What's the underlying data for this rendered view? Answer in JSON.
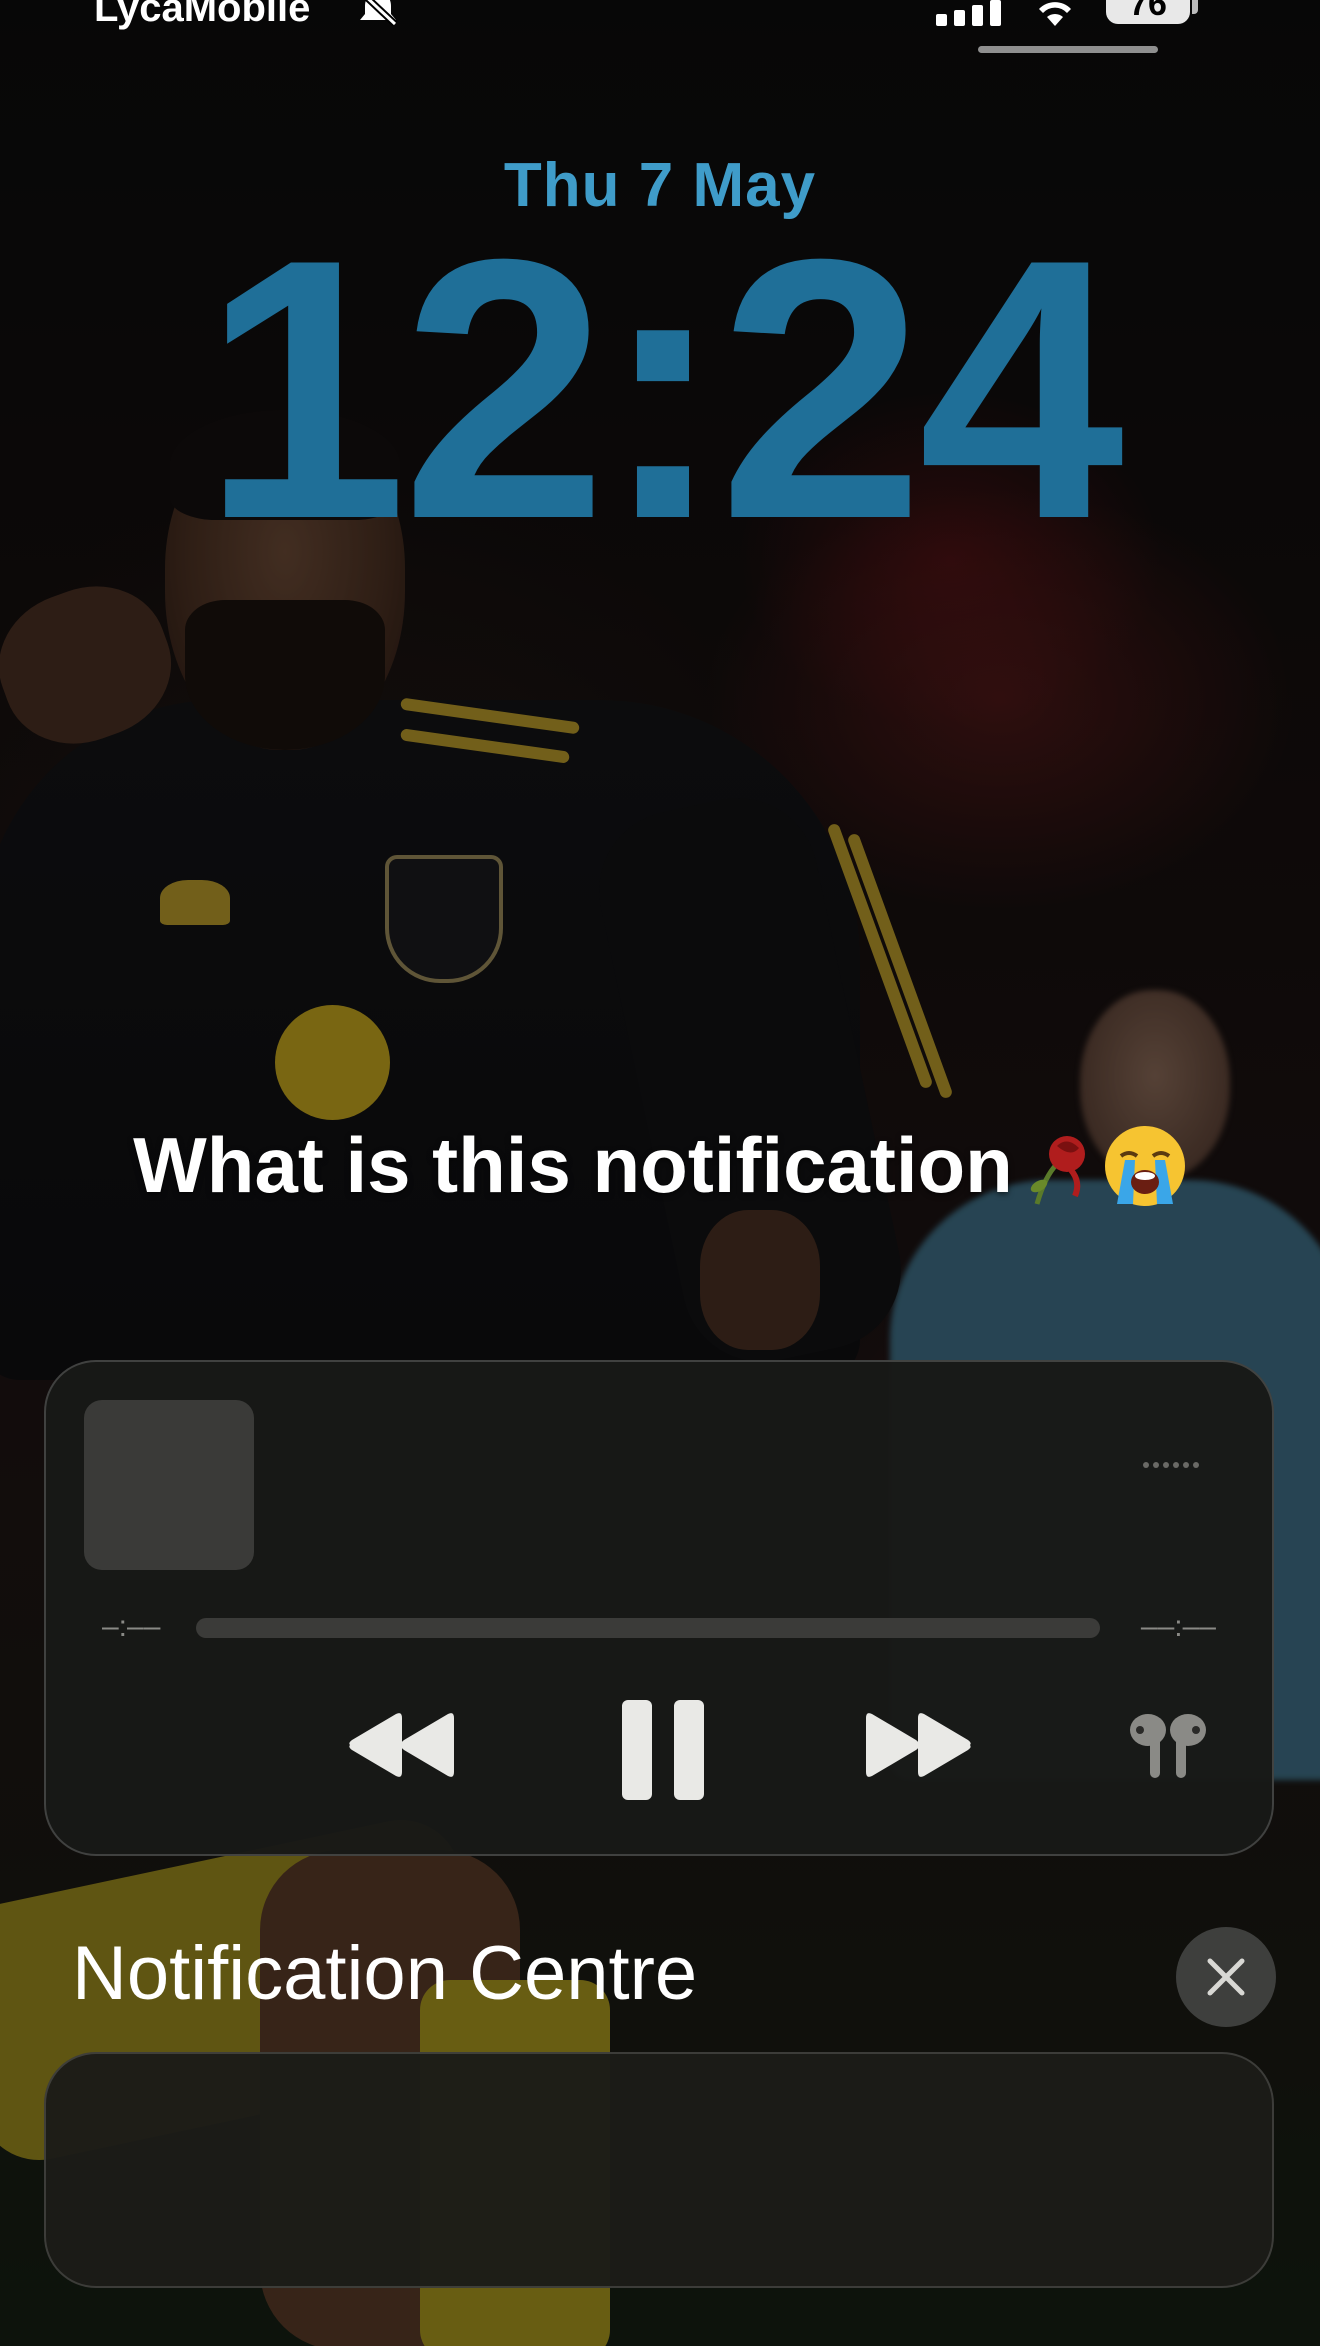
{
  "status_bar": {
    "carrier": "LycaMobile",
    "battery": "76",
    "icons": [
      "bell-slash-icon",
      "cellular-signal-icon",
      "wifi-icon",
      "battery-icon"
    ]
  },
  "lock_screen": {
    "date": "Thu 7 May",
    "time": "12:24"
  },
  "caption": {
    "text": "What is this notification",
    "emoji": [
      "wilted-rose-icon",
      "loudly-crying-face-icon"
    ]
  },
  "media_player": {
    "elapsed": "–:––",
    "remaining": "––:––",
    "progress": 0,
    "controls": [
      "rewind-icon",
      "pause-icon",
      "fast-forward-icon",
      "airpods-icon"
    ]
  },
  "notification_centre": {
    "title": "Notification Centre",
    "close_icon": "close-icon"
  },
  "colors": {
    "date": "#3f9cc9",
    "time": "#1f6f98",
    "card_bg": "#181917"
  }
}
